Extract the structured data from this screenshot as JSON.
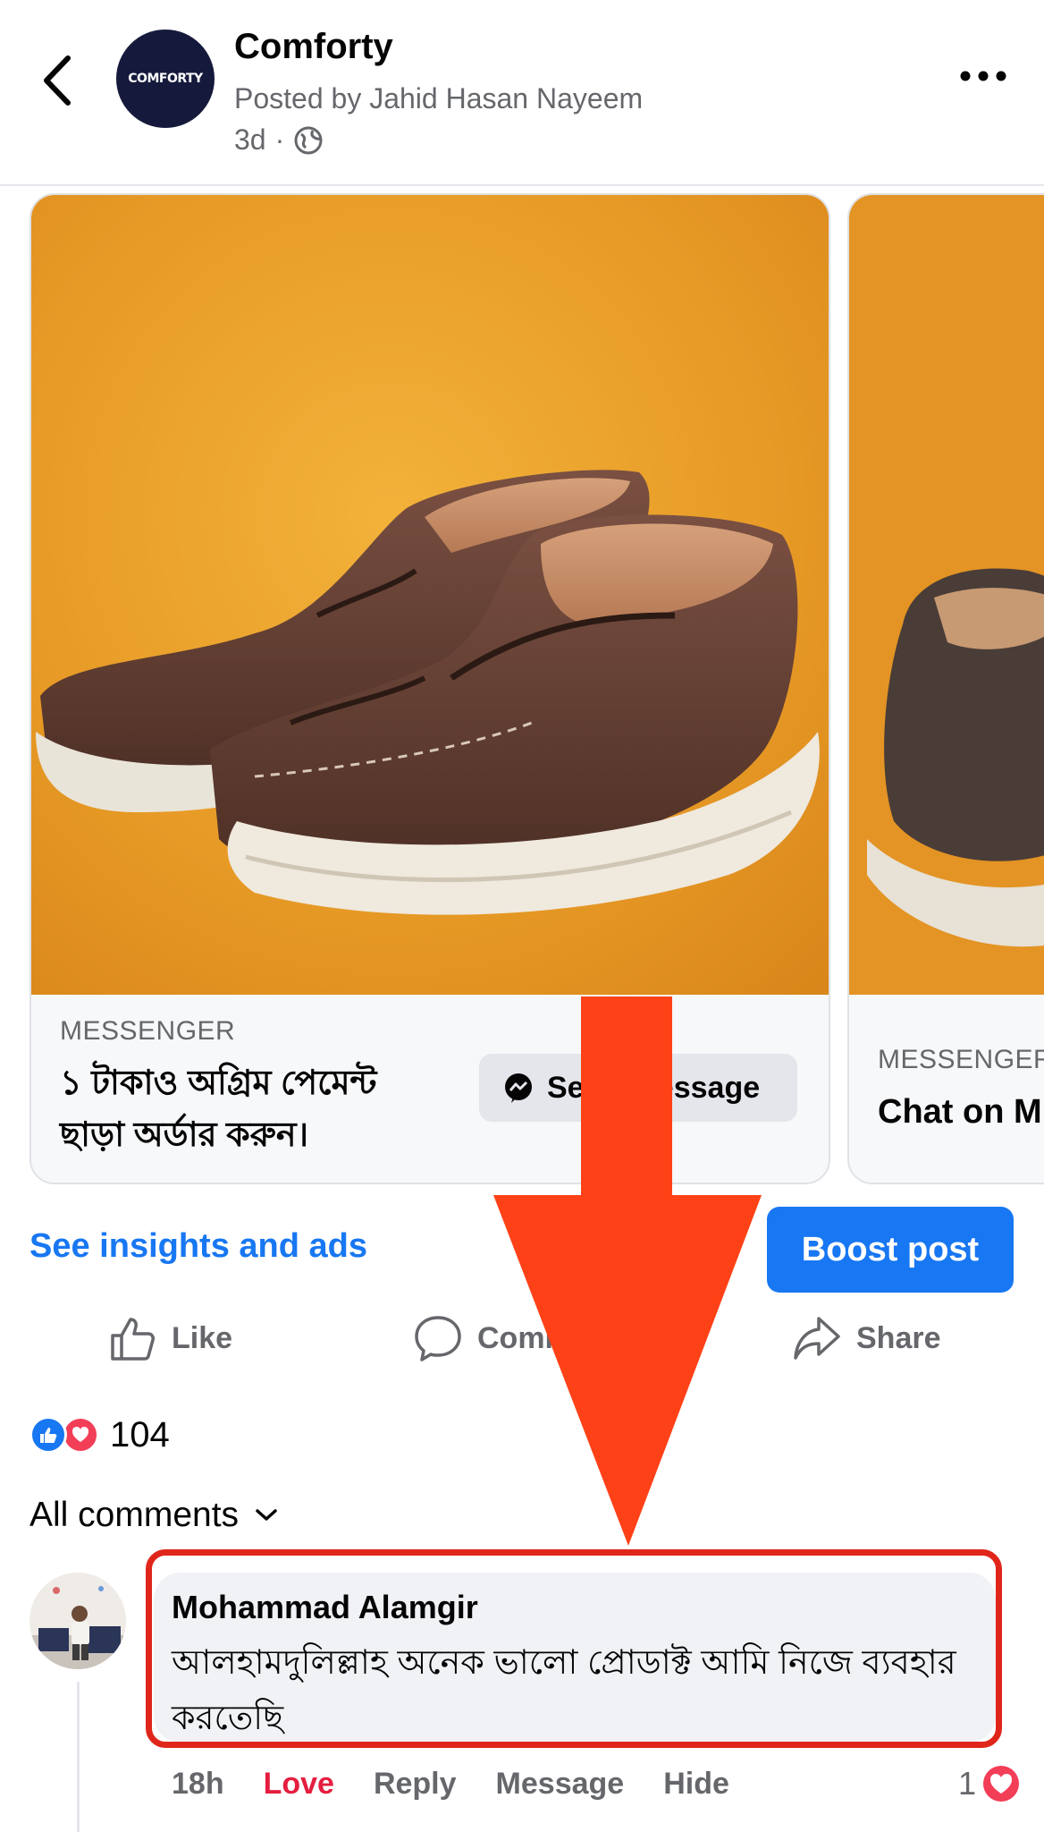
{
  "header": {
    "page_name": "Comforty",
    "logo_text": "COMFORTY",
    "posted_by": "Posted by Jahid Hasan Nayeem",
    "time": "3d",
    "separator": "·",
    "audience_icon": "globe-icon"
  },
  "carousel": {
    "cards": [
      {
        "cta_type": "MESSENGER",
        "headline": "১ টাকাও অগ্রিম পেমেন্ট ছাড়া অর্ডার করুন।",
        "button_label": "Send message"
      },
      {
        "cta_type": "MESSENGER",
        "headline": "Chat on M"
      }
    ]
  },
  "actions": {
    "insights_link": "See insights and ads",
    "boost_label": "Boost post",
    "like_label": "Like",
    "comment_label": "Comment",
    "share_label": "Share"
  },
  "reactions": {
    "count": "104"
  },
  "comments": {
    "filter_label": "All comments",
    "items": [
      {
        "author": "Mohammad Alamgir",
        "text": "আলহামদুলিল্লাহ অনেক ভালো প্রোডাক্ট আমি নিজে ব্যবহার করতেছি",
        "time": "18h",
        "love_label": "Love",
        "reply_label": "Reply",
        "message_label": "Message",
        "hide_label": "Hide",
        "reaction_count": "1"
      }
    ]
  },
  "colors": {
    "accent": "#1877f2",
    "annotation_red": "#ff4117",
    "love_red": "#e41e3f",
    "logo_bg": "#151a3c"
  }
}
